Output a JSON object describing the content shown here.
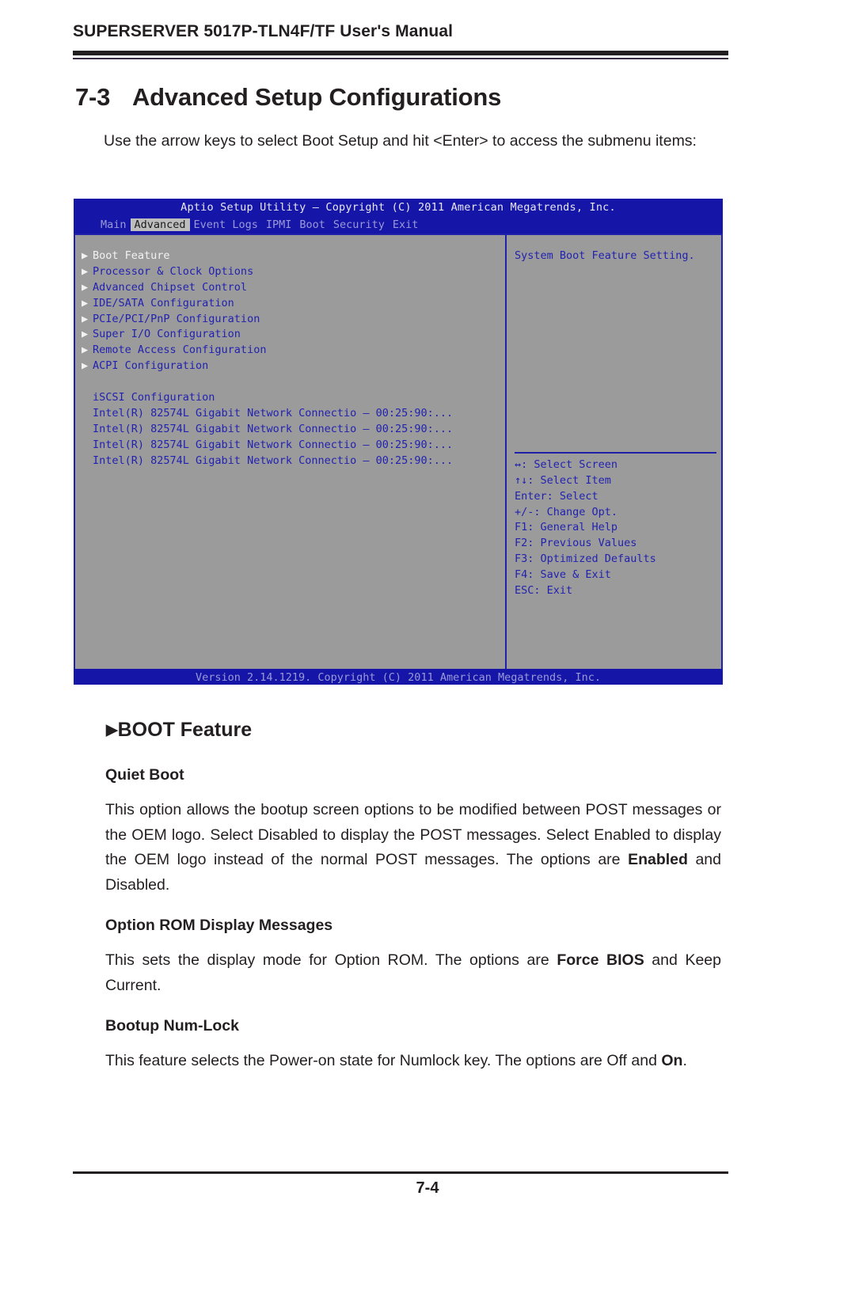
{
  "header": {
    "title_lead": "S",
    "title_small1": "UPER",
    "title_lead2": "S",
    "title_small2": "ERVER",
    "title_rest": " 5017P-TLN4F/TF User's Manual",
    "title_full": "SUPERSERVER 5017P-TLN4F/TF User's Manual"
  },
  "section": {
    "number": "7-3",
    "title": "Advanced Setup Configurations",
    "intro": "Use the arrow keys to select Boot Setup and hit <Enter> to access the submenu items:"
  },
  "bios": {
    "titlebar": "Aptio Setup Utility – Copyright (C) 2011 American Megatrends, Inc.",
    "tabs": [
      {
        "label": "Main",
        "active": false
      },
      {
        "label": "Advanced",
        "active": true
      },
      {
        "label": "Event Logs",
        "active": false
      },
      {
        "label": "IPMI",
        "active": false
      },
      {
        "label": "Boot",
        "active": false
      },
      {
        "label": "Security",
        "active": false
      },
      {
        "label": "Exit",
        "active": false
      }
    ],
    "menu_items": [
      {
        "label": "Boot Feature",
        "arrow": true,
        "selected": true
      },
      {
        "label": "Processor & Clock Options",
        "arrow": true,
        "selected": false
      },
      {
        "label": "Advanced Chipset Control",
        "arrow": true,
        "selected": false
      },
      {
        "label": "IDE/SATA Configuration",
        "arrow": true,
        "selected": false
      },
      {
        "label": "PCIe/PCI/PnP Configuration",
        "arrow": true,
        "selected": false
      },
      {
        "label": "Super I/O Configuration",
        "arrow": true,
        "selected": false
      },
      {
        "label": "Remote Access Configuration",
        "arrow": true,
        "selected": false
      },
      {
        "label": "ACPI Configuration",
        "arrow": true,
        "selected": false
      },
      {
        "label": "",
        "arrow": false,
        "selected": false
      },
      {
        "label": "iSCSI Configuration",
        "arrow": false,
        "selected": false
      },
      {
        "label": "Intel(R) 82574L Gigabit Network Connectio – 00:25:90:...",
        "arrow": false,
        "selected": false
      },
      {
        "label": "Intel(R) 82574L Gigabit Network Connectio – 00:25:90:...",
        "arrow": false,
        "selected": false
      },
      {
        "label": "Intel(R) 82574L Gigabit Network Connectio – 00:25:90:...",
        "arrow": false,
        "selected": false
      },
      {
        "label": "Intel(R) 82574L Gigabit Network Connectio – 00:25:90:...",
        "arrow": false,
        "selected": false
      }
    ],
    "help_text": "System Boot Feature Setting.",
    "keys": [
      "↔: Select Screen",
      "↑↓: Select Item",
      "Enter: Select",
      "+/-: Change Opt.",
      "F1: General Help",
      "F2: Previous Values",
      "F3: Optimized Defaults",
      "F4: Save & Exit",
      "ESC: Exit"
    ],
    "version": "Version 2.14.1219. Copyright (C) 2011 American Megatrends, Inc.",
    "colors": {
      "bar_blue": "#1515a8",
      "panel_gray": "#9b9b9b",
      "text_blue": "#2222b0",
      "highlight": "#bdbdbd"
    }
  },
  "content": {
    "boot_feature_heading": "BOOT Feature",
    "boot_feature_triangle": "▶",
    "quiet_boot": {
      "heading": "Quiet Boot",
      "body_1": "This option allows the bootup screen options to be modified between POST messages or the OEM logo. Select Disabled to display the POST messages. Select Enabled to display the OEM logo instead of the normal POST messages. The options are ",
      "bold_1": "Enabled",
      "body_2": " and Disabled."
    },
    "option_rom": {
      "heading": "Option ROM Display Messages",
      "body_1": "This sets the display mode for Option ROM. The options are ",
      "bold_1": "Force BIOS",
      "body_2": " and Keep Current."
    },
    "bootup_numlock": {
      "heading": "Bootup Num-Lock",
      "body_1": "This feature selects the Power-on state for Numlock key. The options are Off and ",
      "bold_1": "On",
      "body_2": "."
    }
  },
  "footer": {
    "page_number": "7-4"
  }
}
